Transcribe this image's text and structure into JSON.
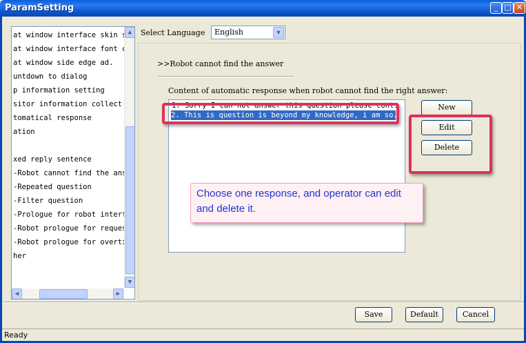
{
  "window": {
    "title": "ParamSetting",
    "controls": {
      "minimize": "_",
      "maximize": "□",
      "close": "✕"
    }
  },
  "tree": {
    "items": [
      "at window interface skin se",
      "at window interface font co",
      "at window side edge ad.",
      "untdown to dialog",
      "p information setting",
      "sitor information collect",
      "tomatical response",
      "ation",
      "",
      "xed reply sentence",
      "-Robot cannot find the answ",
      "-Repeated question",
      "-Filter question",
      "-Prologue for robot interfa",
      "-Robot prologue for request",
      "-Robot prologue for overtim",
      "her"
    ]
  },
  "language": {
    "label": "Select Language",
    "selected": "English"
  },
  "section": {
    "title": ">>Robot cannot find the answer"
  },
  "responses": {
    "caption": "Content of automatic response when robot cannot find the right answer:",
    "items": [
      "1. Sorry I can not answer this question please cont.",
      "2. This is question is beyond my knowledge, i am so."
    ],
    "selected_index": 1
  },
  "buttons": {
    "new": "New",
    "edit": "Edit",
    "delete": "Delete",
    "save": "Save",
    "default": "Default",
    "cancel": "Cancel"
  },
  "annotation": {
    "text": "Choose one response, and operator can edit and delete it.",
    "highlight_color": "#e0305a"
  },
  "status": {
    "text": "Ready"
  }
}
